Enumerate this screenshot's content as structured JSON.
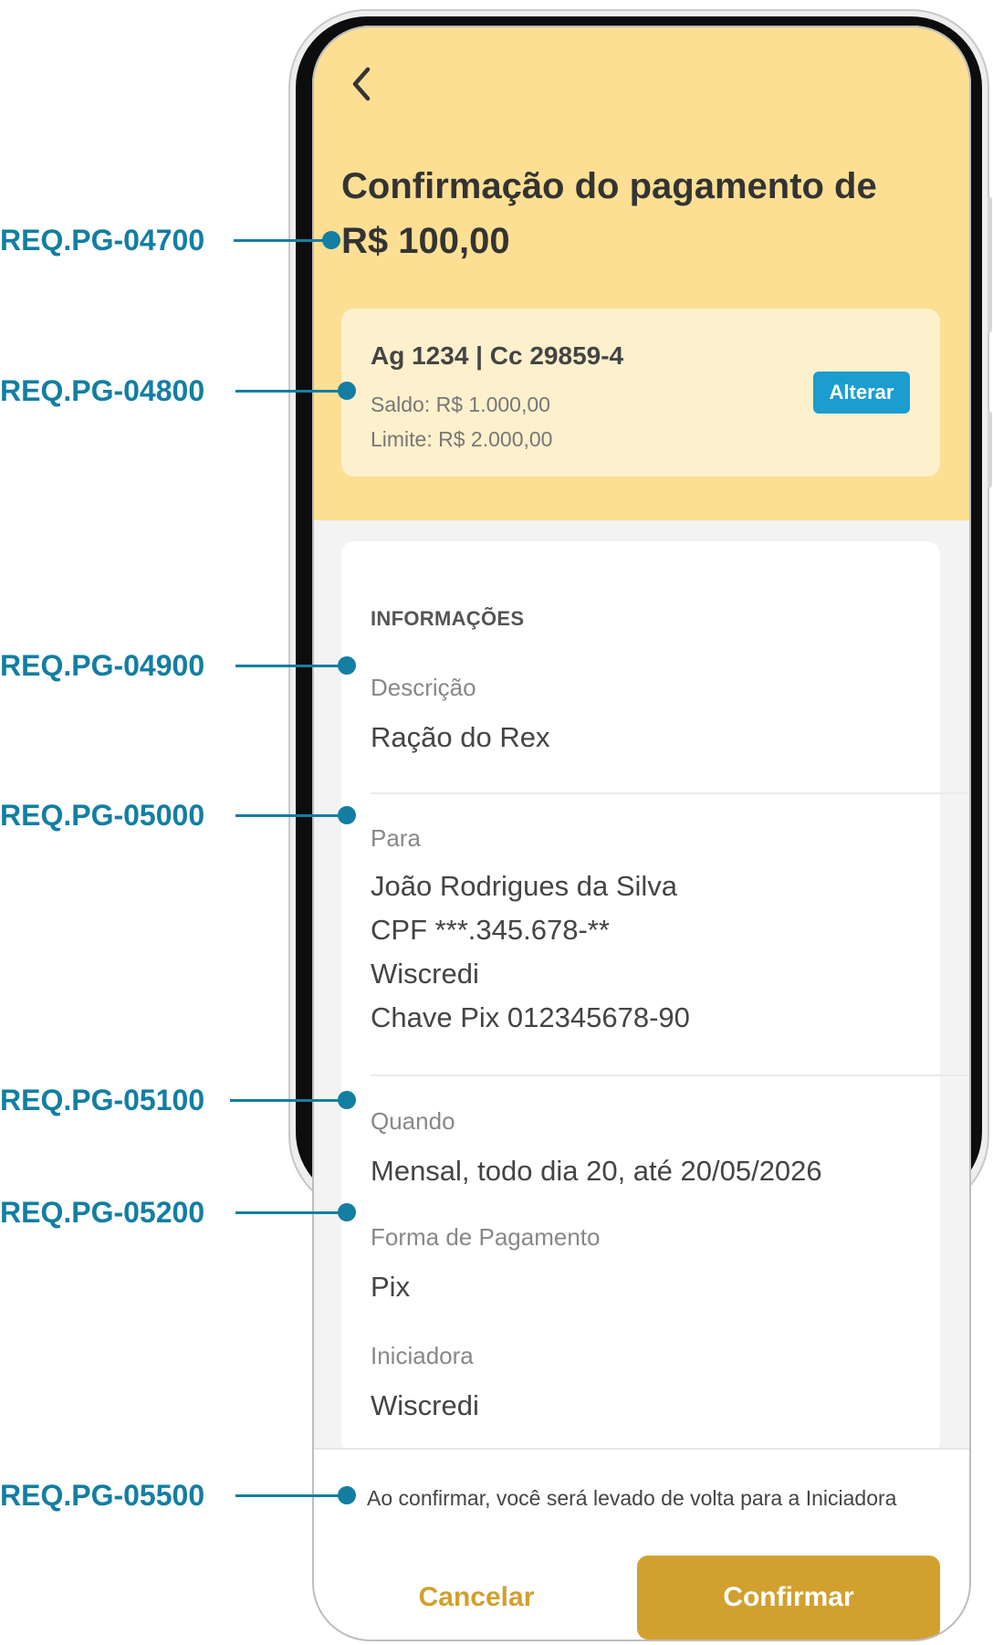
{
  "header": {
    "title": "Confirmação do pagamento de R$ 100,00"
  },
  "account": {
    "title": "Ag 1234 | Cc 29859-4",
    "balance": "Saldo: R$ 1.000,00",
    "limit": "Limite: R$ 2.000,00",
    "change_label": "Alterar"
  },
  "info": {
    "section_title": "INFORMAÇÕES",
    "description": {
      "label": "Descrição",
      "value": "Ração do Rex"
    },
    "payee": {
      "label": "Para",
      "lines": [
        "João Rodrigues da Silva",
        "CPF ***.345.678-**",
        "Wiscredi",
        "Chave Pix 012345678-90"
      ]
    },
    "when": {
      "label": "Quando",
      "value": "Mensal, todo dia 20, até 20/05/2026"
    },
    "payment_method": {
      "label": "Forma de Pagamento",
      "value": "Pix"
    },
    "initiator": {
      "label": "Iniciadora",
      "value": "Wiscredi"
    }
  },
  "footer": {
    "note": "Ao confirmar, você será levado de volta para a Iniciadora",
    "cancel_label": "Cancelar",
    "confirm_label": "Confirmar"
  },
  "annotations": [
    "REQ.PG-04700",
    "REQ.PG-04800",
    "REQ.PG-04900",
    "REQ.PG-05000",
    "REQ.PG-05100",
    "REQ.PG-05200",
    "REQ.PG-05500"
  ],
  "colors": {
    "header_background": "#fddf93",
    "account_card_background": "#fdf0cc",
    "primary_button": "#d1a02e",
    "alter_button": "#1c9dd0",
    "annotation": "#137ea2"
  },
  "icons": {
    "back": "chevron-left-icon"
  }
}
